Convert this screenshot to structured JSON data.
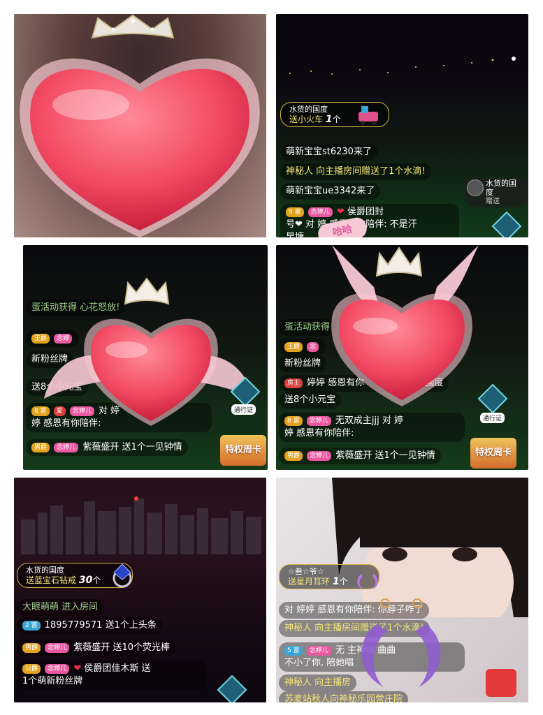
{
  "panel2": {
    "gift_sender": "水货的国度",
    "gift_text": "送小火车",
    "gift_count": "1",
    "gift_unit": "个",
    "chat": [
      "萌新宝宝st6230来了",
      "神秘人 向主播房间赠送了1个水滴!",
      "萌新宝宝ue3342来了"
    ],
    "chat4_badge": "9 富",
    "chat4_fan": "念婷儿",
    "chat4_text": "侯爵团封",
    "chat5_text": "号❤ 对 婷 感恩有你陪伴: 不是汗",
    "chat6_text": "早塘",
    "user_name": "水货的国度",
    "user_sub": "赠送",
    "overlay_text": "哈哈"
  },
  "panel3": {
    "chat_top": "蛋活动获得 心花怒放!",
    "badge_a": "王爵",
    "badge_a_fan": "念婷",
    "new_fan": "新粉丝牌",
    "gift_line": "送8个小元宝",
    "badge_b": "8 富",
    "badge_b2": "爱",
    "badge_b_fan": "念婷儿",
    "line_b": "对 婷",
    "line_b2": "婷 感恩有你陪伴:",
    "badge_c": "男爵",
    "badge_c_fan": "念婷儿",
    "line_c": "紫薇盛开 送1个一见钟情",
    "ticket": "通行证",
    "week": "特权周卡"
  },
  "panel4": {
    "chat_top": "蛋活动获得",
    "badge_a": "王爵",
    "badge_a_fan": "念",
    "new_fan": "新粉丝牌",
    "badge_room": "房主",
    "room_line": "婷婷 感恩有你",
    "room_line_end": "的国度",
    "gift_line": "送8个小元宝",
    "badge_b": "8 富",
    "badge_b_fan": "念婷儿",
    "line_b": "无双成主jjj 对 婷",
    "line_b2": "婷 感恩有你陪伴:",
    "badge_c": "男爵",
    "badge_c_fan": "念婷儿",
    "line_c": "紫薇盛开 送1个一见钟情",
    "ticket": "通行证",
    "week": "特权周卡"
  },
  "panel5": {
    "gift_sender": "水货的国度",
    "gift_text": "送蓝宝石钻戒",
    "gift_count": "30",
    "gift_unit": "个",
    "chat_top": "大眼萌萌 进入房间",
    "badge_a": "2 富",
    "line_a": "1895779571 送1个上头条",
    "badge_b": "男爵",
    "badge_b_fan": "念婷儿",
    "line_b": "紫薇盛开 送10个荧光棒",
    "badge_c": "公爵",
    "badge_c_fan": "念婷儿",
    "line_c": "侯爵团佳木斯",
    "line_c_end": "送",
    "line_c2": "1个萌新粉丝牌"
  },
  "panel6": {
    "gift_sender": "☆叁☆爷☆",
    "gift_text": "送星月耳环",
    "gift_count": "1",
    "gift_unit": "个",
    "chat": [
      "对 婷婷 感恩有你陪伴: 你脖子咋了",
      "神秘人 向主播房间赠送了1个水滴!"
    ],
    "badge_a": "5 富",
    "badge_a_fan": "念婷儿",
    "line_a": "无",
    "line_a_end": "主神仙 曲曲",
    "line_a2": "不小了你, 陪她唱",
    "chat_last": "神秘人 向主播房",
    "chat_last2": "苏麦站秋人向神秘乐园营庄院"
  }
}
